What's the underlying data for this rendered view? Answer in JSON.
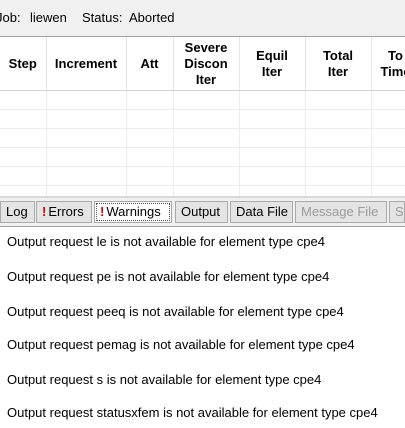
{
  "job": {
    "job_label": "Job:",
    "job_value": "liewen",
    "status_label": "Status:",
    "status_value": "Aborted"
  },
  "table": {
    "headers": [
      [
        "Step"
      ],
      [
        "Increment"
      ],
      [
        "Att"
      ],
      [
        "Severe",
        "Discon",
        "Iter"
      ],
      [
        "Equil",
        "Iter"
      ],
      [
        "Total",
        "Iter"
      ],
      [
        "To",
        "Time"
      ]
    ]
  },
  "tabs": [
    {
      "label": "Log",
      "warn": false,
      "state": "normal"
    },
    {
      "label": "Errors",
      "warn": true,
      "state": "normal"
    },
    {
      "label": "Warnings",
      "warn": true,
      "state": "active"
    },
    {
      "label": "Output",
      "warn": false,
      "state": "normal"
    },
    {
      "label": "Data File",
      "warn": false,
      "state": "normal"
    },
    {
      "label": "Message File",
      "warn": false,
      "state": "disabled"
    },
    {
      "label": "St",
      "warn": false,
      "state": "disabled"
    }
  ],
  "warnings": [
    "Output request le is not available for element type cpe4",
    "Output request pe is not available for element type cpe4",
    "Output request peeq is not available for element type cpe4",
    "Output request pemag is not available for element type cpe4",
    "Output request s is not available for element type cpe4",
    "Output request statusxfem is not available for element type cpe4"
  ]
}
